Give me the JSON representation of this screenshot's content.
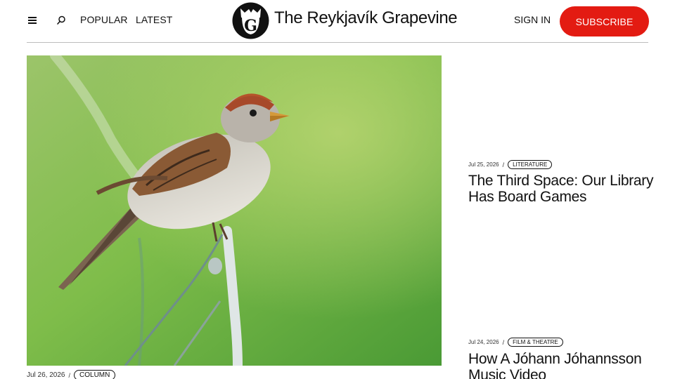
{
  "header": {
    "nav": [
      "POPULAR",
      "LATEST"
    ],
    "site_title": "The Reykjavík Grapevine",
    "logo_letter": "G",
    "signin_label": "SIGN IN",
    "subscribe_label": "SUBSCRIBE",
    "menu_icon": "hamburger-menu-icon",
    "search_icon": "search-icon"
  },
  "hero": {
    "date": "Jul 26, 2026",
    "separator": "/",
    "tag": "COLUMN"
  },
  "side_articles": [
    {
      "date": "Jul 25, 2026",
      "separator": "/",
      "tag": "LITERATURE",
      "title": "The Third Space: Our Library Has Board Games"
    },
    {
      "date": "Jul 24, 2026",
      "separator": "/",
      "tag": "FILM & THEATRE",
      "title": "How A Jóhann Jóhannsson Music Video"
    }
  ],
  "colors": {
    "accent": "#e31b12",
    "rule": "#bdbdbd",
    "text": "#111111"
  }
}
